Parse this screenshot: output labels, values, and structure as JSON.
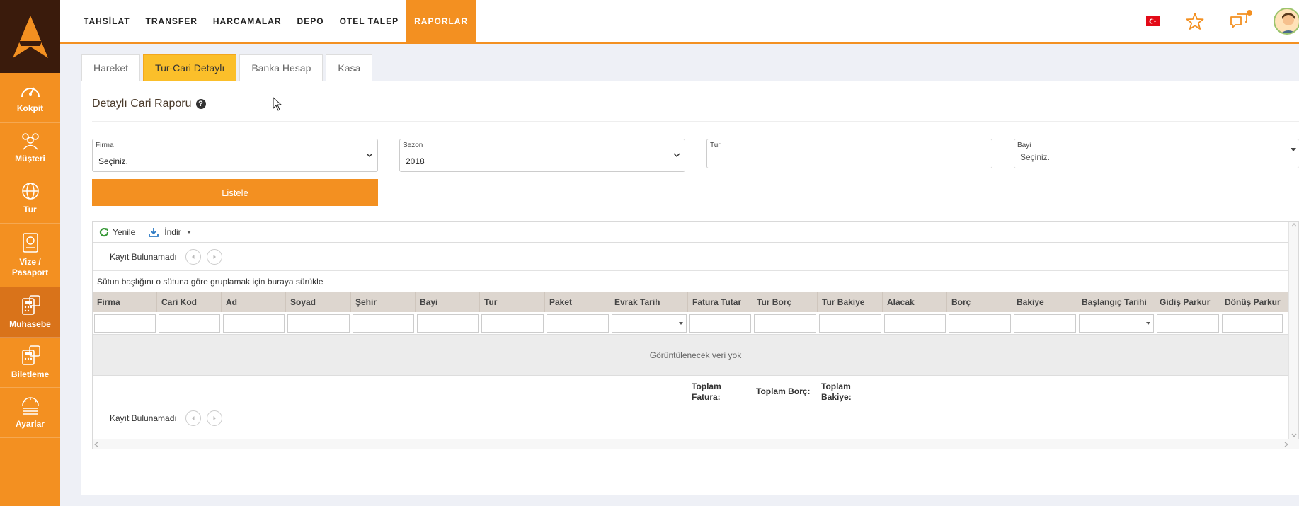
{
  "sidebar": {
    "items": [
      {
        "label": "Kokpit",
        "icon": "speedometer-icon"
      },
      {
        "label": "Müşteri",
        "icon": "users-icon"
      },
      {
        "label": "Tur",
        "icon": "globe-icon"
      },
      {
        "label": "Vize / Pasaport",
        "icon": "passport-icon"
      },
      {
        "label": "Muhasebe",
        "icon": "calculator-icon",
        "active": true
      },
      {
        "label": "Biletleme",
        "icon": "ticket-icon"
      },
      {
        "label": "Ayarlar",
        "icon": "settings-icon"
      }
    ]
  },
  "topnav": {
    "items": [
      "TAHSİLAT",
      "TRANSFER",
      "HARCAMALAR",
      "DEPO",
      "OTEL TALEP",
      "RAPORLAR"
    ],
    "active": "RAPORLAR"
  },
  "tabs": [
    "Hareket",
    "Tur-Cari Detaylı",
    "Banka Hesap",
    "Kasa"
  ],
  "report": {
    "title": "Detaylı Cari Raporu",
    "help": "?"
  },
  "filters": {
    "firma": {
      "label": "Firma",
      "value": "Seçiniz."
    },
    "sezon": {
      "label": "Sezon",
      "value": "2018"
    },
    "tur": {
      "label": "Tur",
      "value": ""
    },
    "bayi": {
      "label": "Bayi",
      "value": "Seçiniz."
    },
    "submit": "Listele"
  },
  "grid": {
    "toolbar": {
      "refresh": "Yenile",
      "download": "İndir"
    },
    "pager_text": "Kayıt Bulunamadı",
    "group_hint": "Sütun başlığını o sütuna göre gruplamak için buraya sürükle",
    "columns": [
      "Firma",
      "Cari Kod",
      "Ad",
      "Soyad",
      "Şehir",
      "Bayi",
      "Tur",
      "Paket",
      "Evrak Tarih",
      "Fatura Tutar",
      "Tur Borç",
      "Tur Bakiye",
      "Alacak",
      "Borç",
      "Bakiye",
      "Başlangıç Tarihi",
      "Gidiş Parkur",
      "Dönüş Parkur"
    ],
    "empty": "Görüntülenecek veri yok",
    "totals": {
      "fatura": "Toplam Fatura:",
      "borc": "Toplam Borç:",
      "bakiye": "Toplam Bakiye:"
    }
  },
  "colors": {
    "accent": "#f39021",
    "dark": "#3a1b0c",
    "active_tab": "#fbbf2a"
  }
}
